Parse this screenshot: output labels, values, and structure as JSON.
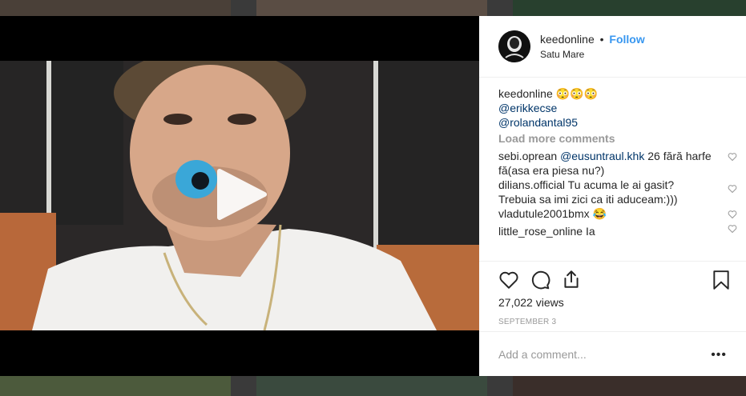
{
  "post": {
    "username": "keedonline",
    "separator": "•",
    "follow_label": "Follow",
    "location": "Satu Mare",
    "caption_user": "keedonline",
    "caption_emoji": "😳😳😳",
    "caption_mentions": [
      "@erikkecse",
      "@rolandantal95"
    ],
    "load_more_label": "Load more comments",
    "comments": [
      {
        "user": "sebi.oprean",
        "mention": "@eusuntraul.khk",
        "text": "26 fără harfe fă(asa era piesa nu?)"
      },
      {
        "user": "dilians.official",
        "text": "Tu acuma le ai gasit? Trebuia sa imi zici ca iti aduceam:)))"
      },
      {
        "user": "vladutule2001bmx",
        "text": "😂"
      },
      {
        "user": "little_rose_online",
        "text": "Ia"
      }
    ],
    "views": "27,022 views",
    "date": "SEPTEMBER 3",
    "add_comment_placeholder": "Add a comment...",
    "more_label": "•••"
  },
  "icons": {
    "like": "heart-icon",
    "comment": "comment-icon",
    "share": "share-icon",
    "save": "bookmark-icon",
    "play": "play-icon"
  },
  "colors": {
    "link": "#3897f0",
    "mention": "#003569",
    "muted": "#999999",
    "text": "#262626"
  }
}
